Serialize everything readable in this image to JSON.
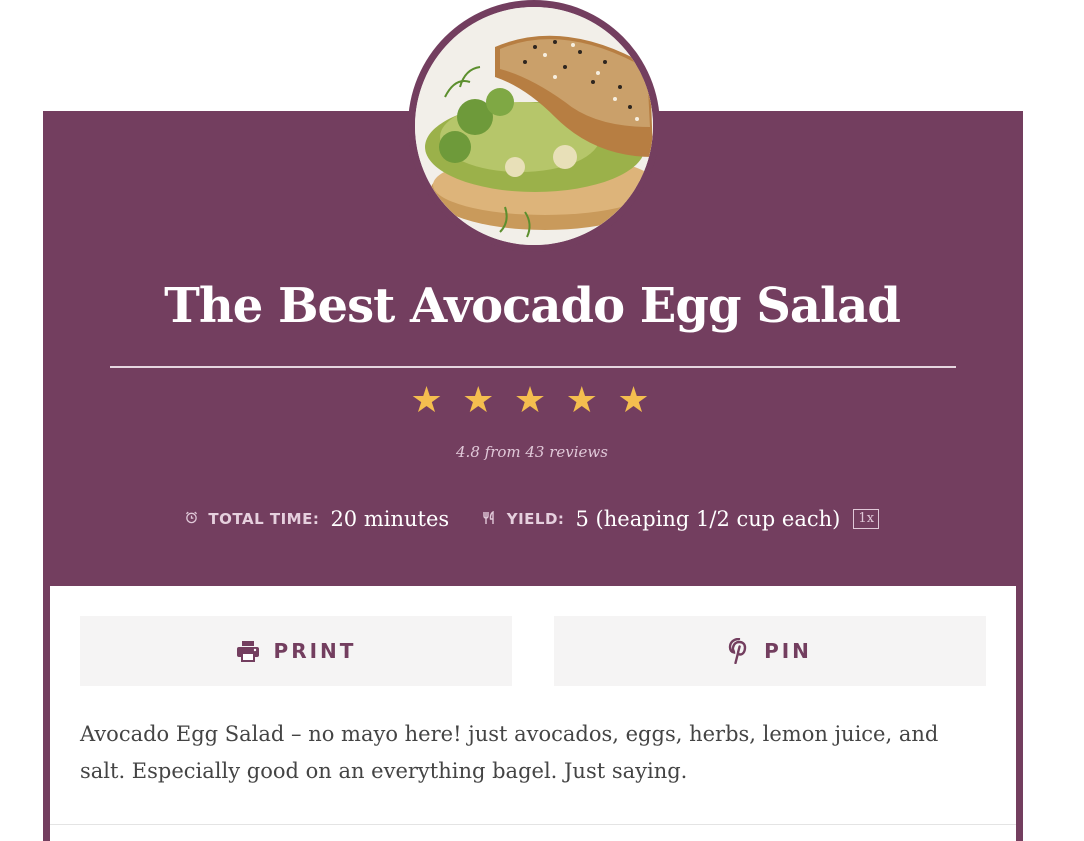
{
  "recipe": {
    "title": "The Best Avocado Egg Salad",
    "rating": {
      "stars": 4.8,
      "max": 5,
      "text": "4.8 from 43 reviews"
    },
    "total_time": {
      "label": "TOTAL TIME:",
      "value": "20 minutes",
      "icon": "alarm-clock-icon"
    },
    "yield": {
      "label": "YIELD:",
      "value": "5 (heaping 1/2 cup each)",
      "scale": "1x",
      "icon": "fork-knife-icon"
    },
    "buttons": {
      "print": "PRINT",
      "pin": "PIN"
    },
    "description": "Avocado Egg Salad – no mayo here! just avocados, eggs, herbs, lemon juice, and salt. Especially good on an everything bagel. Just saying."
  },
  "colors": {
    "brand": "#733e5f",
    "star": "#f4be4f",
    "button_bg": "#f5f4f4",
    "text": "#444444"
  }
}
